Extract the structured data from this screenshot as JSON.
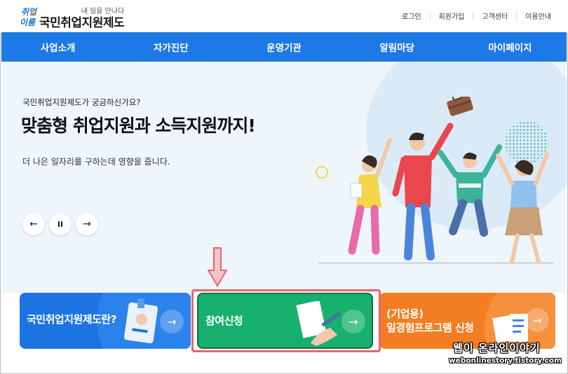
{
  "header": {
    "logo_mark_line1": "취업",
    "logo_mark_line2": "이룸",
    "logo_tagline": "내 일을 만나다",
    "logo_name": "국민취업지원제도",
    "util_links": [
      "로그인",
      "회원가입",
      "고객센터",
      "이용안내"
    ]
  },
  "gnb": {
    "items": [
      "사업소개",
      "자가진단",
      "운영기관",
      "알림마당",
      "마이페이지"
    ]
  },
  "hero": {
    "subtitle": "국민취업지원제도가 궁금하신가요?",
    "title": "맞춤형 취업지원과 소득지원까지!",
    "description": "더 나은 일자리를 구하는데 영향을 줍니다.",
    "controls": {
      "prev": "←",
      "pause": "II",
      "next": "→"
    }
  },
  "cards": {
    "about": {
      "label": "국민취업지원제도란?",
      "arrow": "→"
    },
    "apply": {
      "label": "참여신청",
      "arrow": "→"
    },
    "company": {
      "label_line1": "(기업용)",
      "label_line2": "일경험프로그램 신청",
      "arrow": "→"
    }
  },
  "watermark": {
    "line1": "웹이 온라인이야기",
    "line2": "webonlinestory.tistory.com"
  },
  "colors": {
    "nav_blue": "#1c79e6",
    "card_blue": "#1b74e2",
    "card_green": "#17b06e",
    "card_orange": "#f27d22",
    "highlight_red": "#e8656e"
  }
}
